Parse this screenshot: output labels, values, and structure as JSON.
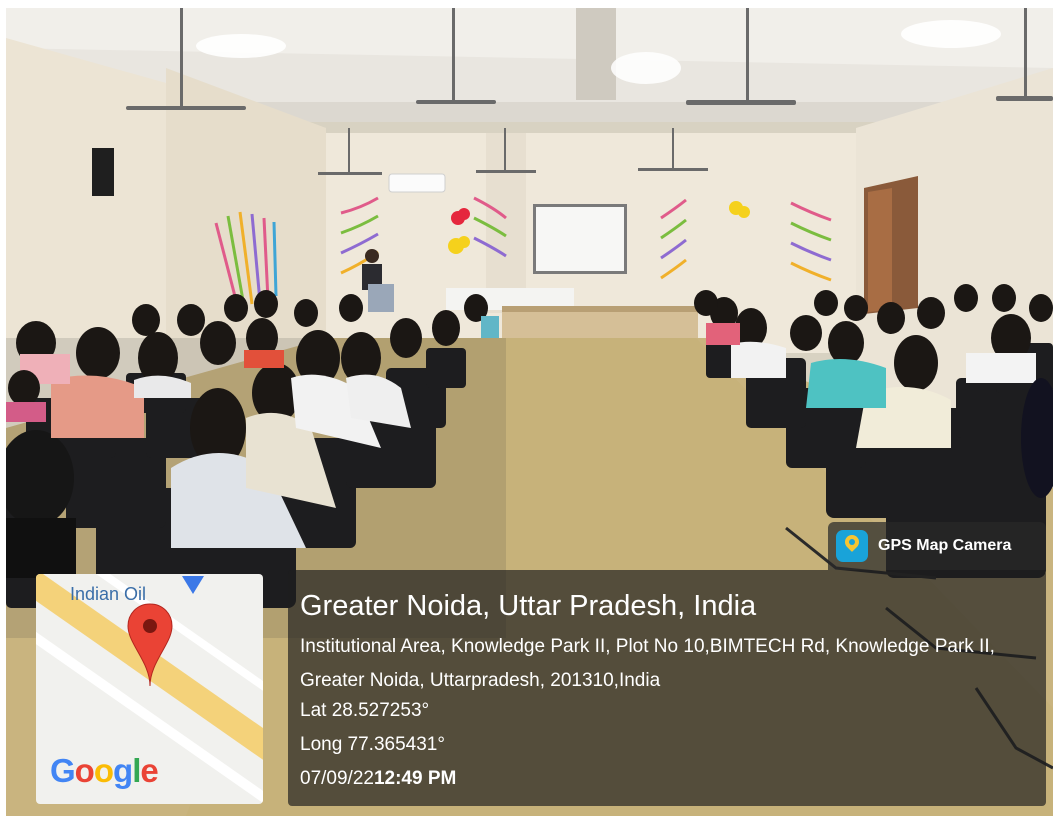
{
  "photo": {
    "subject": "seminar-hall-audience"
  },
  "gps_badge": {
    "icon": "gps-map-camera-icon",
    "label": "GPS Map Camera"
  },
  "location": {
    "city": "Greater Noida, Uttar Pradesh, India",
    "address": "Institutional Area, Knowledge Park II, Plot No 10,BIMTECH Rd, Knowledge Park II, Greater Noida, Uttarpradesh, 201310,India",
    "lat": "Lat 28.527253°",
    "long": "Long 77.365431°",
    "date": "07/09/22",
    "time": "12:49 PM"
  },
  "map": {
    "poi_label": "Indian Oil",
    "logo": "Google",
    "marker_color": "#ea4335",
    "road_color": "#f4d27a"
  }
}
